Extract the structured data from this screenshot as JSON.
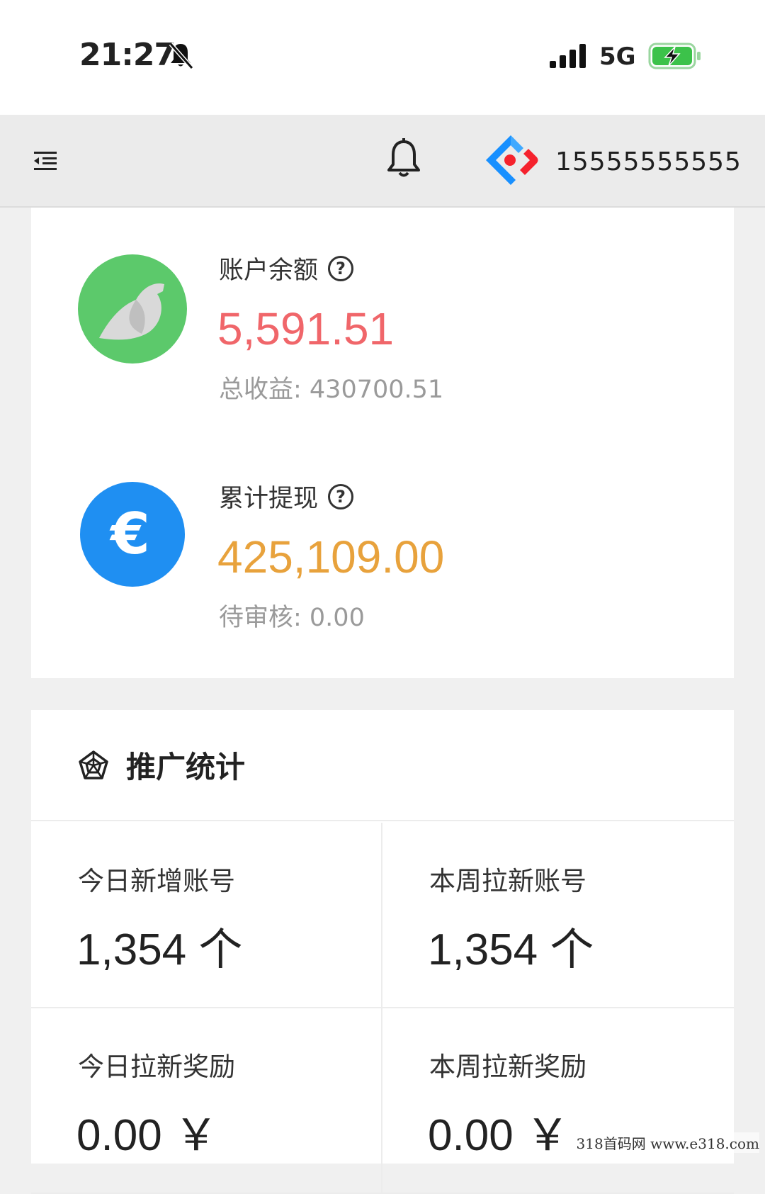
{
  "status_bar": {
    "time": "21:27",
    "network": "5G"
  },
  "header": {
    "phone": "15555555555"
  },
  "balance_card": {
    "account_balance": {
      "label": "账户余额",
      "value": "5,591.51",
      "sub_label": "总收益: 430700.51",
      "value_color": "#f0666a",
      "icon_bg": "#5cc96b"
    },
    "withdrawn": {
      "label": "累计提现",
      "value": "425,109.00",
      "sub_label": "待审核: 0.00",
      "value_color": "#e8a23c",
      "icon_bg": "#1f8ff2"
    }
  },
  "promo_card": {
    "title": "推广统计",
    "items": [
      {
        "label": "今日新增账号",
        "value": "1,354 个"
      },
      {
        "label": "本周拉新账号",
        "value": "1,354 个"
      },
      {
        "label": "今日拉新奖励",
        "value": "0.00 ￥"
      },
      {
        "label": "本周拉新奖励",
        "value": "0.00 ￥"
      }
    ]
  },
  "watermark": "318首码网  www.e318.com"
}
